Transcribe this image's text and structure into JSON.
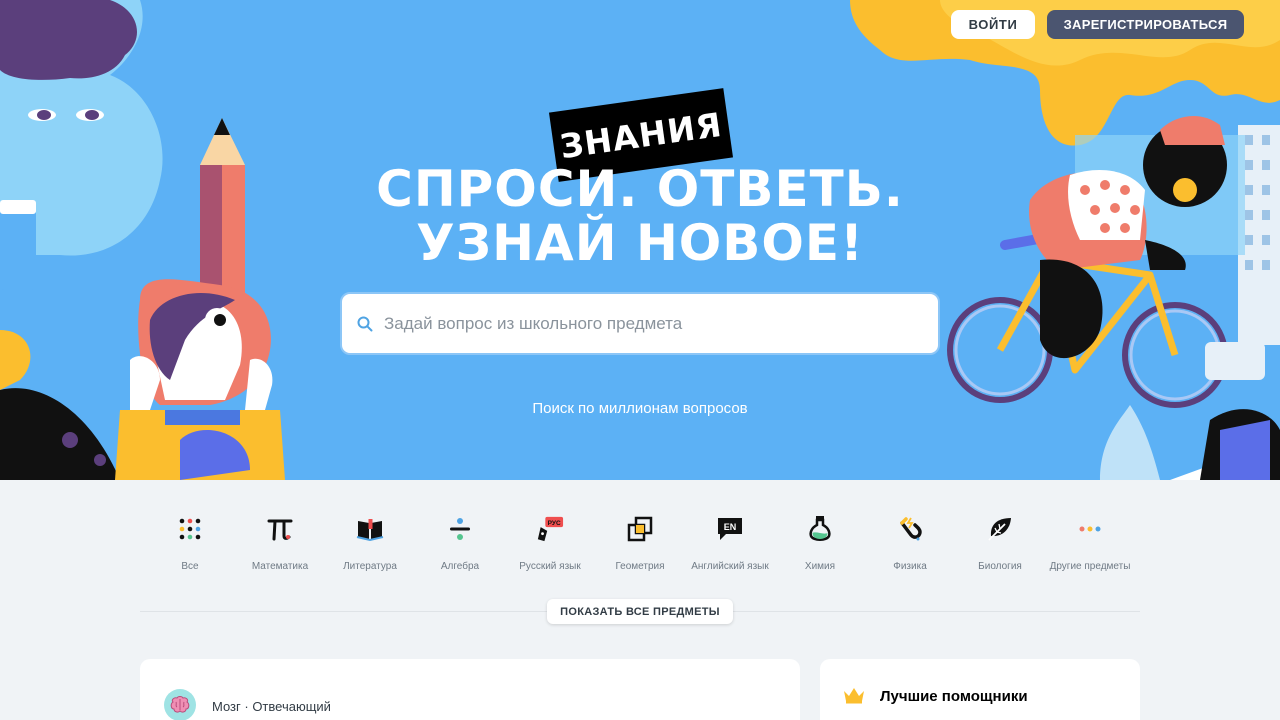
{
  "header": {
    "login_label": "ВОЙТИ",
    "register_label": "ЗАРЕГИСТРИРОВАТЬСЯ"
  },
  "hero": {
    "logo_text": "ЗНАНИЯ",
    "headline_line1": "СПРОСИ. ОТВЕТЬ.",
    "headline_line2": "УЗНАЙ НОВОЕ!",
    "search_placeholder": "Задай вопрос из школьного предмета",
    "search_hint": "Поиск по миллионам вопросов"
  },
  "subjects": [
    {
      "label": "Все",
      "icon": "grid-dots-icon"
    },
    {
      "label": "Математика",
      "icon": "pi-icon"
    },
    {
      "label": "Литература",
      "icon": "book-icon"
    },
    {
      "label": "Алгебра",
      "icon": "divide-icon"
    },
    {
      "label": "Русский язык",
      "icon": "pen-nib-rus-icon",
      "badge": "РУС"
    },
    {
      "label": "Геометрия",
      "icon": "overlapping-squares-icon"
    },
    {
      "label": "Английский язык",
      "icon": "speech-bubble-en-icon",
      "badge": "EN"
    },
    {
      "label": "Химия",
      "icon": "flask-icon"
    },
    {
      "label": "Физика",
      "icon": "magnet-icon"
    },
    {
      "label": "Биология",
      "icon": "leaf-icon"
    },
    {
      "label": "Другие предметы",
      "icon": "three-dots-icon"
    }
  ],
  "show_all_label": "ПОКАЗАТЬ ВСЕ ПРЕДМЕТЫ",
  "feed": {
    "author_label": "Мозг · Отвечающий"
  },
  "sidebar": {
    "best_helpers_title": "Лучшие помощники"
  },
  "colors": {
    "hero_bg": "#5cb1f5",
    "page_bg": "#f0f3f6",
    "register_bg": "#4b5570",
    "accent_yellow": "#fbbe2e",
    "accent_red": "#ef4e4e"
  }
}
